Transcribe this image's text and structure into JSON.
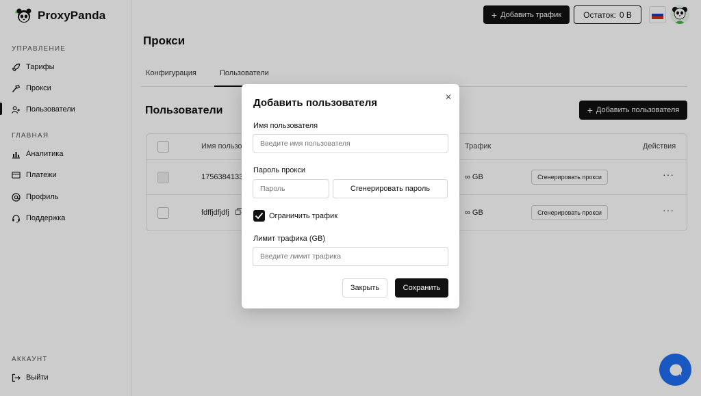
{
  "brand": {
    "name": "ProxyPanda"
  },
  "sidebar": {
    "sections": {
      "manage": "УПРАВЛЕНИЕ",
      "main": "ГЛАВНАЯ",
      "account": "АККАУНТ"
    },
    "items": [
      {
        "label": "Тарифы",
        "icon": "rocket-icon"
      },
      {
        "label": "Прокси",
        "icon": "hammer-icon"
      },
      {
        "label": "Пользователи",
        "icon": "user-plus-icon",
        "active": true
      },
      {
        "label": "Аналитика",
        "icon": "bar-chart-icon"
      },
      {
        "label": "Платежи",
        "icon": "card-icon"
      },
      {
        "label": "Профиль",
        "icon": "at-icon"
      },
      {
        "label": "Поддержка",
        "icon": "headset-icon"
      }
    ],
    "logout": "Выйти"
  },
  "header": {
    "add_traffic": "Добавить трафик",
    "balance_label": "Остаток:",
    "balance_value": "0 B",
    "language": "ru"
  },
  "page": {
    "title": "Прокси",
    "tabs": [
      "Конфигурация",
      "Пользователи"
    ],
    "active_tab": 1,
    "section_title": "Пользователи",
    "add_user_button": "Добавить пользователя"
  },
  "table": {
    "columns": [
      "Имя пользо",
      "Трафик",
      "Действия"
    ],
    "rows": [
      {
        "name": "1756384133",
        "traffic": "∞ GB",
        "action": "Сгенерировать прокси"
      },
      {
        "name": "fdffjdfjdfj",
        "traffic": "∞ GB",
        "action": "Сгенерировать прокси"
      }
    ]
  },
  "modal": {
    "title": "Добавить пользователя",
    "username_label": "Имя пользователя",
    "username_placeholder": "Введите имя пользователя",
    "password_label": "Пароль прокси",
    "password_placeholder": "Пароль",
    "generate_password": "Сгенерировать пароль",
    "limit_traffic_checkbox": "Ограничить трафик",
    "limit_traffic_checked": true,
    "traffic_limit_label": "Лимит трафика (GB)",
    "traffic_limit_placeholder": "Введите лимит трафика",
    "close_button": "Закрыть",
    "save_button": "Сохранить"
  },
  "colors": {
    "accent": "#111111",
    "chat": "#1f6ff0"
  }
}
